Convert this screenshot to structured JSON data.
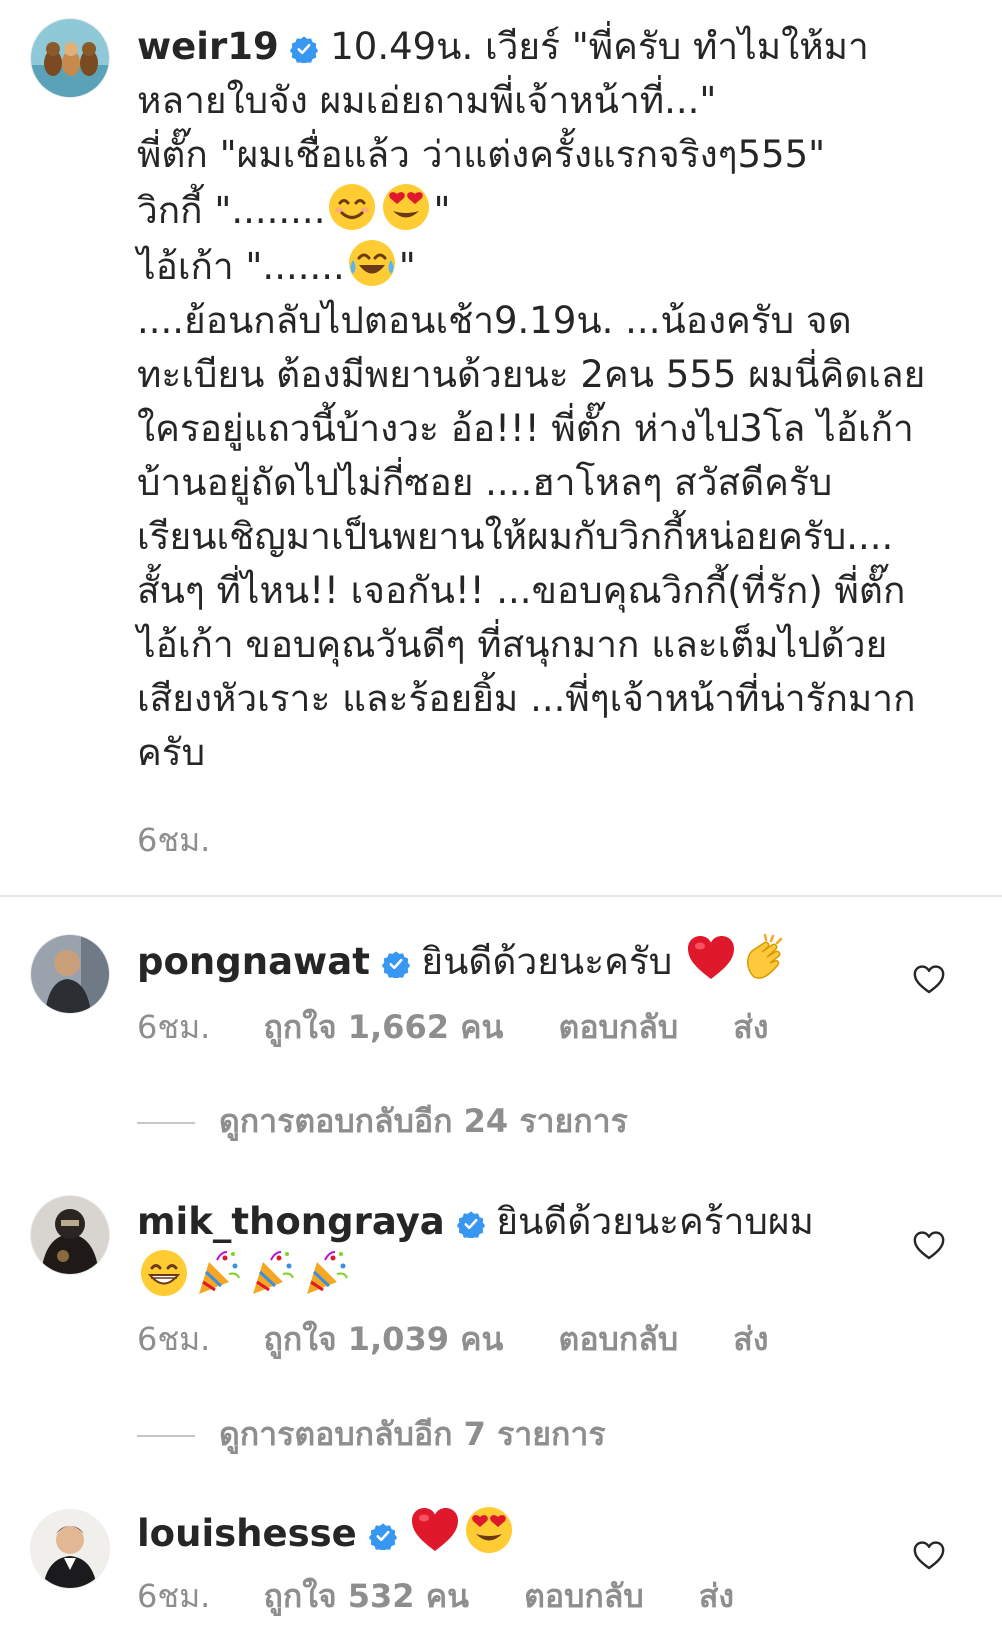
{
  "post": {
    "username": "weir19",
    "caption_lines": [
      "10.49น. เวียร์ \"พี่ครับ ทำไมให้มา",
      "หลายใบจัง ผมเอ่ยถามพี่เจ้าหน้าที่...\"",
      "พี่ตั๊ก \"ผมเชื่อแล้ว ว่าแต่งครั้งแรกจริงๆ555\"",
      "วิกกี้ \"........",
      "ไอ้เก้า \".......",
      "....ย้อนกลับไปตอนเช้า9.19น. ...น้องครับ จด",
      "ทะเบียน ต้องมีพยานด้วยนะ 2คน 555 ผมนี่คิดเลย",
      "ใครอยู่แถวนี้บ้างวะ อ้อ!!! พี่ตั๊ก ห่างไป3โล ไอ้เก้า",
      "บ้านอยู่ถัดไปไม่กี่ซอย ....ฮาโหลๆ สวัสดีครับ",
      "เรียนเชิญมาเป็นพยานให้ผมกับวิกกี้หน่อยครับ....",
      "สั้นๆ ที่ไหน!! เจอกัน!! ...ขอบคุณวิกกี้(ที่รัก) พี่ตั๊ก",
      "ไอ้เก้า ขอบคุณวันดีๆ ที่สนุกมาก และเต็มไปด้วย",
      "เสียงหัวเราะ และร้อยยิ้ม ...พี่ๆเจ้าหน้าที่น่ารักมาก",
      "ครับ"
    ],
    "quote_close": "\"",
    "time": "6ชม."
  },
  "comments": [
    {
      "username": "pongnawat",
      "text": "ยินดีด้วยนะครับ",
      "time": "6ชม.",
      "likes": "ถูกใจ 1,662 คน",
      "reply": "ตอบกลับ",
      "send": "ส่ง",
      "view_replies": "ดูการตอบกลับอีก 24 รายการ",
      "emojis": [
        "red-heart",
        "clapping-hands"
      ]
    },
    {
      "username": "mik_thongraya",
      "text": "ยินดีด้วยนะคร้าบผม",
      "time": "6ชม.",
      "likes": "ถูกใจ 1,039 คน",
      "reply": "ตอบกลับ",
      "send": "ส่ง",
      "view_replies": "ดูการตอบกลับอีก 7 รายการ",
      "emojis": [
        "grinning-face",
        "party-popper",
        "party-popper",
        "party-popper"
      ]
    },
    {
      "username": "louishesse",
      "text": "",
      "time": "6ชม.",
      "likes": "ถูกใจ 532 คน",
      "reply": "ตอบกลับ",
      "send": "ส่ง",
      "emojis": [
        "red-heart",
        "heart-eyes-face"
      ]
    }
  ],
  "colors": {
    "text": "#262626",
    "secondary": "#8e8e8e",
    "verified": "#3897f0",
    "divider": "#e6e6e6"
  },
  "icons": [
    "verified-badge-icon",
    "heart-outline-icon"
  ]
}
